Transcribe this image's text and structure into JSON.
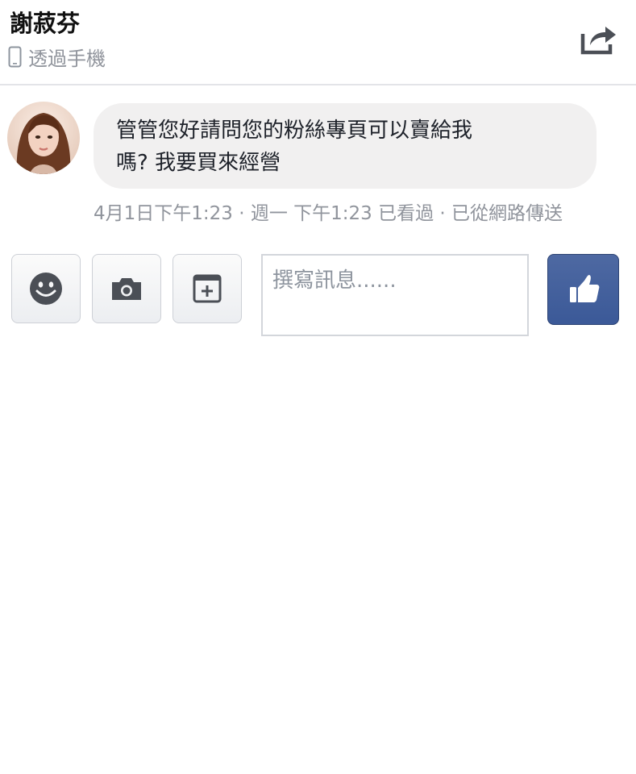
{
  "header": {
    "contact_name": "謝菽芬",
    "via_label": "透過手機"
  },
  "icons": {
    "device": "mobile-phone-icon",
    "share": "share-icon",
    "emoji": "smiley-icon",
    "camera": "camera-icon",
    "attach": "add-item-icon",
    "like": "thumbs-up-icon"
  },
  "message": {
    "text_line1": "管管您好請問您的粉絲專頁可以賣給我",
    "text_line2": "嗎? 我要買來經營",
    "meta": "4月1日下午1:23 · 週一 下午1:23 已看過 · 已從網路傳送"
  },
  "composer": {
    "placeholder": "撰寫訊息......"
  },
  "colors": {
    "brand": "#3b5998",
    "bubble": "#f1f0f0",
    "muted_text": "#90949c"
  }
}
